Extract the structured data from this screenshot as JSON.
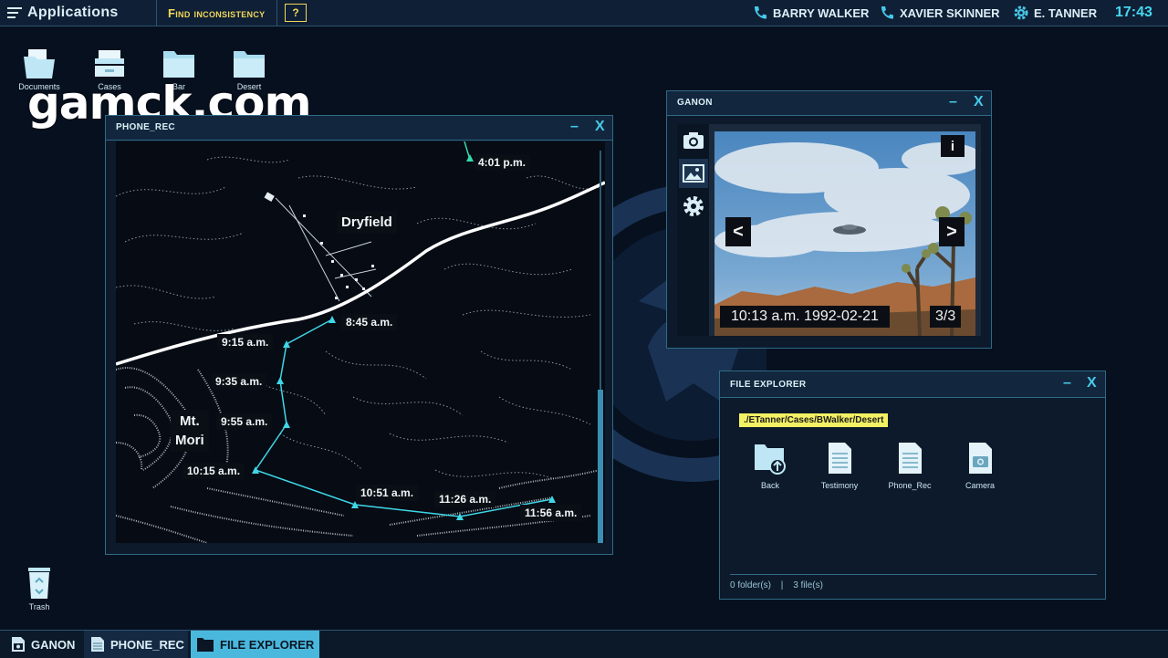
{
  "topbar": {
    "apps_label": "Applications",
    "find_label": "Find inconsistency",
    "help_label": "?",
    "contacts": [
      {
        "name": "BARRY WALKER",
        "icon": "phone-icon"
      },
      {
        "name": "XAVIER SKINNER",
        "icon": "phone-icon"
      },
      {
        "name": "E. TANNER",
        "icon": "gear-icon"
      }
    ],
    "clock": "17:43"
  },
  "watermark": "gamck.com",
  "desktop": {
    "icons": [
      {
        "label": "Documents",
        "icon": "documents-folder-icon"
      },
      {
        "label": "Cases",
        "icon": "cases-tray-icon"
      },
      {
        "label": "Bar",
        "icon": "folder-icon"
      },
      {
        "label": "Desert",
        "icon": "folder-icon"
      }
    ],
    "trash_label": "Trash"
  },
  "phone_rec": {
    "title": "PHONE_REC",
    "minimize": "–",
    "close": "X",
    "places": {
      "town": "Dryfield",
      "mountain_line1": "Mt.",
      "mountain_line2": "Mori"
    },
    "timestamps": [
      "4:01 p.m.",
      "8:45 a.m.",
      "9:15 a.m.",
      "9:35 a.m.",
      "9:55 a.m.",
      "10:15 a.m.",
      "10:51 a.m.",
      "11:26 a.m.",
      "11:56 a.m."
    ],
    "route_color": "#3fd6e6",
    "road_color": "#ffffff"
  },
  "ganon": {
    "title": "GANON",
    "minimize": "–",
    "close": "X",
    "side_icons": [
      "camera-icon",
      "image-icon",
      "gear-icon"
    ],
    "info": "i",
    "prev": "<",
    "next": ">",
    "photo_caption": "10:13 a.m. 1992-02-21",
    "counter": "3/3"
  },
  "file_explorer": {
    "title": "FILE EXPLORER",
    "minimize": "–",
    "close": "X",
    "path": "./ETanner/Cases/BWalker/Desert",
    "items": [
      {
        "label": "Back",
        "icon": "back-folder-icon"
      },
      {
        "label": "Testimony",
        "icon": "document-icon"
      },
      {
        "label": "Phone_Rec",
        "icon": "document-icon"
      },
      {
        "label": "Camera",
        "icon": "camera-file-icon"
      }
    ],
    "folders": "0 folder(s)",
    "separator": "|",
    "files": "3 file(s)"
  },
  "taskbar": {
    "tasks": [
      {
        "label": "GANON",
        "icon": "camera-icon",
        "active": false
      },
      {
        "label": "PHONE_REC",
        "icon": "document-icon",
        "active": false
      },
      {
        "label": "FILE EXPLORER",
        "icon": "folder-icon",
        "active": true
      }
    ]
  },
  "colors": {
    "accent": "#46d6f0",
    "highlight": "#f0d85a",
    "path_pill": "#f3f064",
    "active_task": "#4ab8dd"
  }
}
